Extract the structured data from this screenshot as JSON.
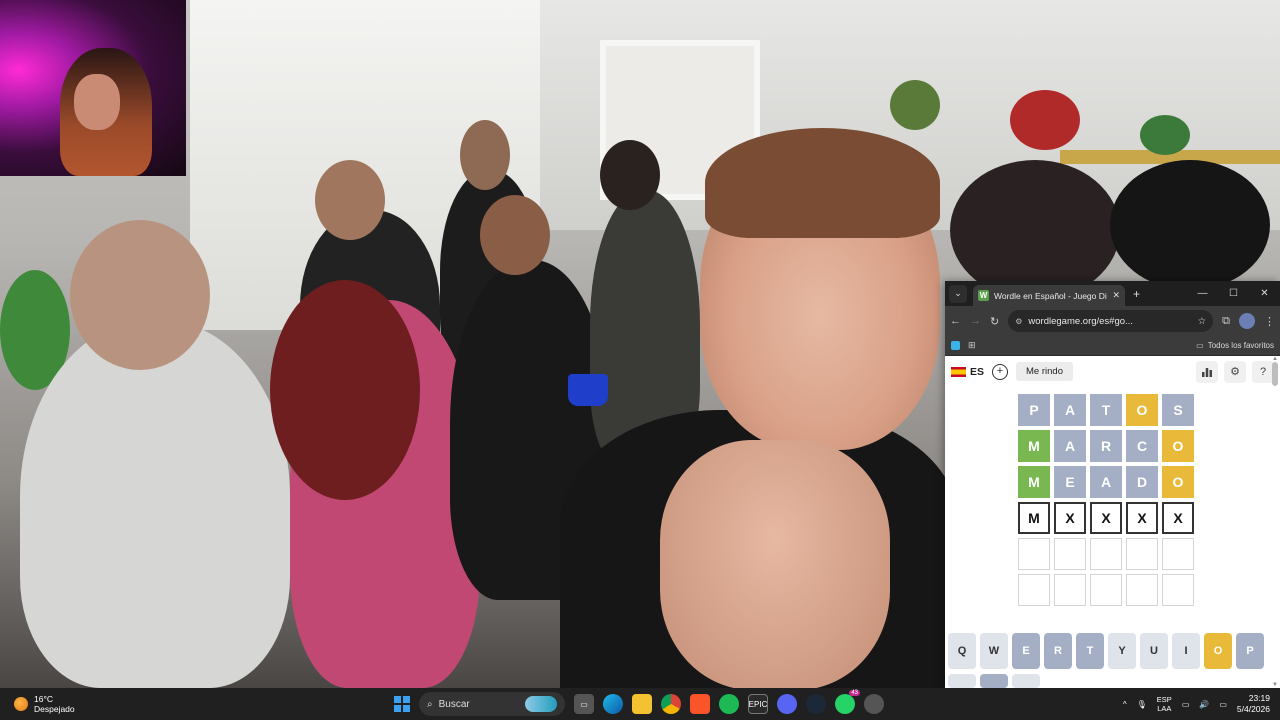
{
  "browser": {
    "tab": {
      "favicon": "W",
      "title": "Wordle en Español - Juego Diario"
    },
    "controls": {
      "dropdown": "⌄",
      "close_tab": "✕",
      "new_tab": "+",
      "minimize": "—",
      "maximize": "☐",
      "close": "✕"
    },
    "nav": {
      "back": "←",
      "forward": "→",
      "reload": "↻",
      "url": "wordlegame.org/es#go...",
      "star": "☆",
      "extensions": "⧉",
      "menu": "⋮"
    },
    "bookmarks": {
      "folder_label": "Todos los favoritos"
    }
  },
  "game": {
    "language": "ES",
    "add_label": "+",
    "give_up_label": "Me rindo",
    "icons": [
      "stats-icon",
      "settings-icon",
      "help-icon"
    ],
    "board": [
      [
        {
          "l": "P",
          "s": "absent"
        },
        {
          "l": "A",
          "s": "absent"
        },
        {
          "l": "T",
          "s": "absent"
        },
        {
          "l": "O",
          "s": "present"
        },
        {
          "l": "S",
          "s": "absent"
        }
      ],
      [
        {
          "l": "M",
          "s": "correct"
        },
        {
          "l": "A",
          "s": "absent"
        },
        {
          "l": "R",
          "s": "absent"
        },
        {
          "l": "C",
          "s": "absent"
        },
        {
          "l": "O",
          "s": "present"
        }
      ],
      [
        {
          "l": "M",
          "s": "correct"
        },
        {
          "l": "E",
          "s": "absent"
        },
        {
          "l": "A",
          "s": "absent"
        },
        {
          "l": "D",
          "s": "absent"
        },
        {
          "l": "O",
          "s": "present"
        }
      ],
      [
        {
          "l": "M",
          "s": "typed"
        },
        {
          "l": "X",
          "s": "typed"
        },
        {
          "l": "X",
          "s": "typed"
        },
        {
          "l": "X",
          "s": "typed"
        },
        {
          "l": "X",
          "s": "typed"
        }
      ],
      [
        {
          "l": "",
          "s": "empty"
        },
        {
          "l": "",
          "s": "empty"
        },
        {
          "l": "",
          "s": "empty"
        },
        {
          "l": "",
          "s": "empty"
        },
        {
          "l": "",
          "s": "empty"
        }
      ],
      [
        {
          "l": "",
          "s": "empty"
        },
        {
          "l": "",
          "s": "empty"
        },
        {
          "l": "",
          "s": "empty"
        },
        {
          "l": "",
          "s": "empty"
        },
        {
          "l": "",
          "s": "empty"
        }
      ]
    ],
    "keyboard_row1": [
      {
        "k": "Q",
        "s": "unused"
      },
      {
        "k": "W",
        "s": "unused"
      },
      {
        "k": "E",
        "s": "absent"
      },
      {
        "k": "R",
        "s": "absent"
      },
      {
        "k": "T",
        "s": "absent"
      },
      {
        "k": "Y",
        "s": "unused"
      },
      {
        "k": "U",
        "s": "unused"
      },
      {
        "k": "I",
        "s": "unused"
      },
      {
        "k": "O",
        "s": "present"
      },
      {
        "k": "P",
        "s": "absent"
      }
    ],
    "colors": {
      "absent": "#a4aec4",
      "present": "#e9ba3a",
      "correct": "#79b851"
    }
  },
  "taskbar": {
    "weather": {
      "temp": "16°C",
      "condition": "Despejado"
    },
    "search_label": "Buscar",
    "apps": [
      "task-view-icon",
      "edge-icon",
      "file-explorer-icon",
      "chrome-icon",
      "brave-icon",
      "spotify-icon",
      "epic-games-icon",
      "discord-icon",
      "steam-icon",
      "whatsapp-icon",
      "app-icon"
    ],
    "whatsapp_badge": "43",
    "tray": {
      "chevron": "^",
      "lang_top": "ESP",
      "lang_bottom": "LAA",
      "time": "23:19",
      "date": "5/4/2026"
    }
  }
}
